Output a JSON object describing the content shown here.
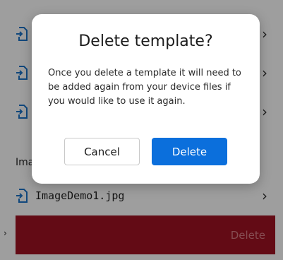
{
  "background": {
    "files": [
      {
        "label": ""
      },
      {
        "label": ""
      },
      {
        "label": ""
      },
      {
        "label": "ImageDemo1.jpg"
      }
    ],
    "section_label": "Ima",
    "delete_bar_label": "Delete",
    "edge_arrow": "›"
  },
  "dialog": {
    "title": "Delete template?",
    "message": "Once you delete a template it will need to be added again from your device files if you would like to use it again.",
    "cancel_label": "Cancel",
    "delete_label": "Delete"
  },
  "colors": {
    "accent": "#0b6fdc",
    "danger": "#a11322",
    "icon": "#1a73c9"
  },
  "icons": {
    "file": "file-import-icon",
    "chevron": "chevron-right-icon"
  }
}
